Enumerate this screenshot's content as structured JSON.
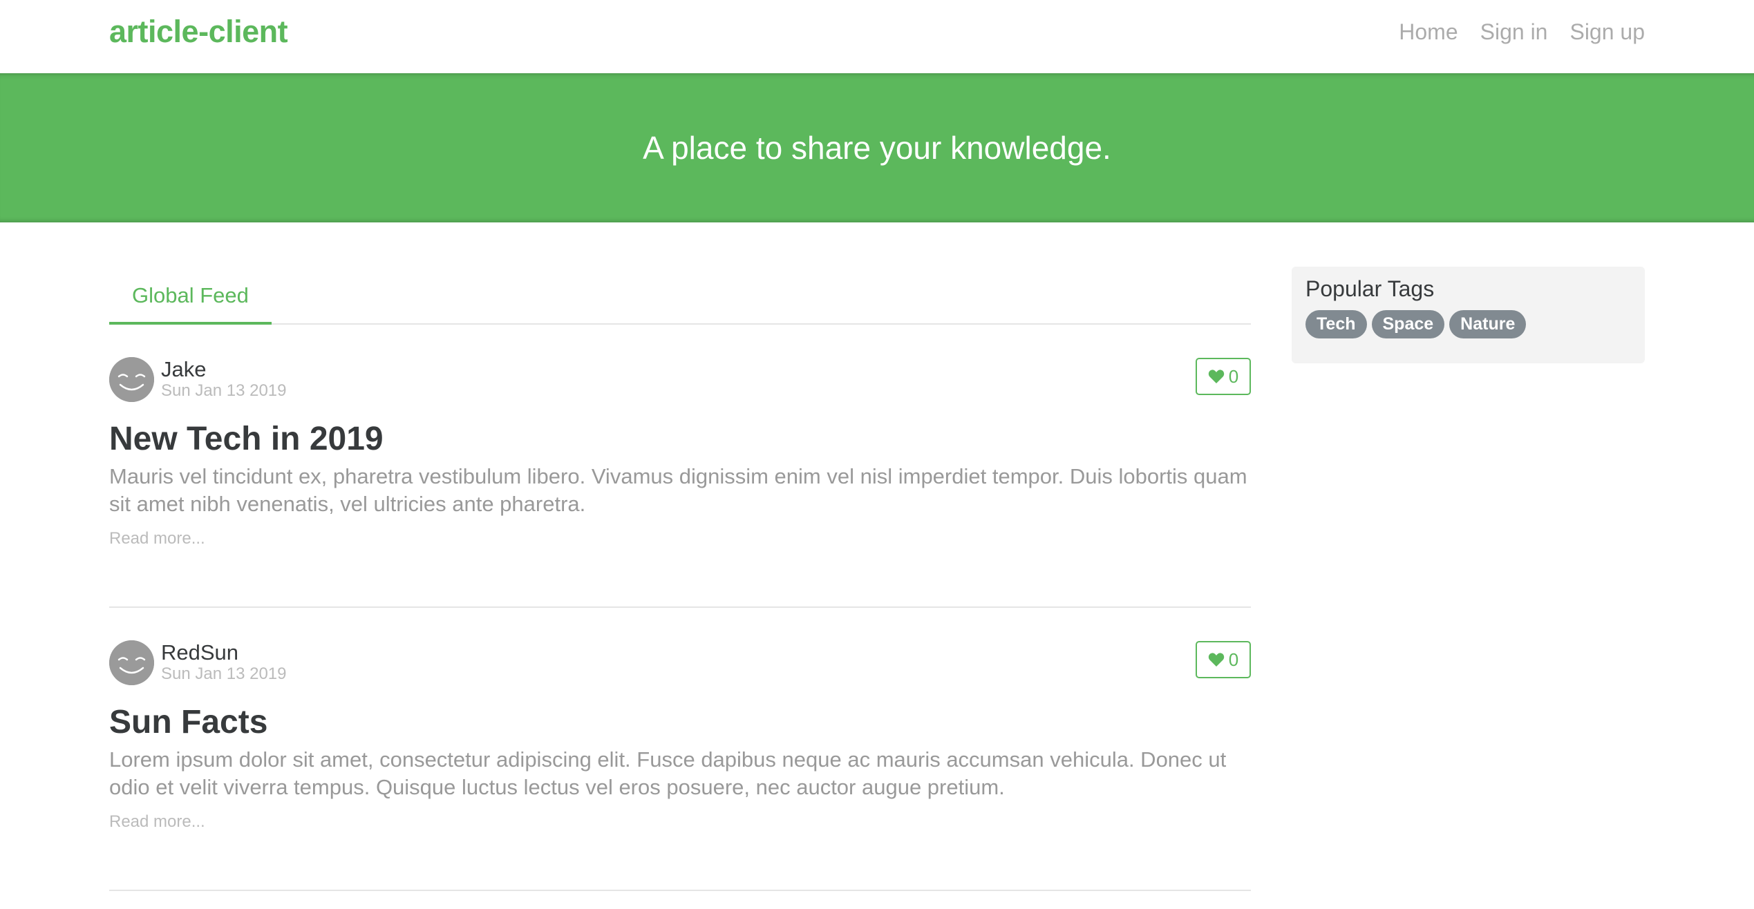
{
  "brand": "article-client",
  "nav": [
    "Home",
    "Sign in",
    "Sign up"
  ],
  "banner": {
    "tagline": "A place to share your knowledge."
  },
  "feed": {
    "tab_label": "Global Feed",
    "articles": [
      {
        "author": "Jake",
        "date": "Sun Jan 13 2019",
        "favorites": "0",
        "title": "New Tech in 2019",
        "description": "Mauris vel tincidunt ex, pharetra vestibulum libero. Vivamus dignissim enim vel nisl imperdiet tempor. Duis lobortis quam sit amet nibh venenatis, vel ultricies ante pharetra.",
        "read_more": "Read more..."
      },
      {
        "author": "RedSun",
        "date": "Sun Jan 13 2019",
        "favorites": "0",
        "title": "Sun Facts",
        "description": "Lorem ipsum dolor sit amet, consectetur adipiscing elit. Fusce dapibus neque ac mauris accumsan vehicula. Donec ut odio et velit viverra tempus. Quisque luctus lectus vel eros posuere, nec auctor augue pretium.",
        "read_more": "Read more..."
      }
    ]
  },
  "sidebar": {
    "title": "Popular Tags",
    "tags": [
      "Tech",
      "Space",
      "Nature"
    ]
  },
  "colors": {
    "accent": "#5cb85c",
    "tag_bg": "#818a91",
    "sidebar_bg": "#f3f3f3",
    "muted_text": "#999999"
  },
  "icons": {
    "favorite": "heart-icon",
    "avatar": "smiley-avatar"
  }
}
